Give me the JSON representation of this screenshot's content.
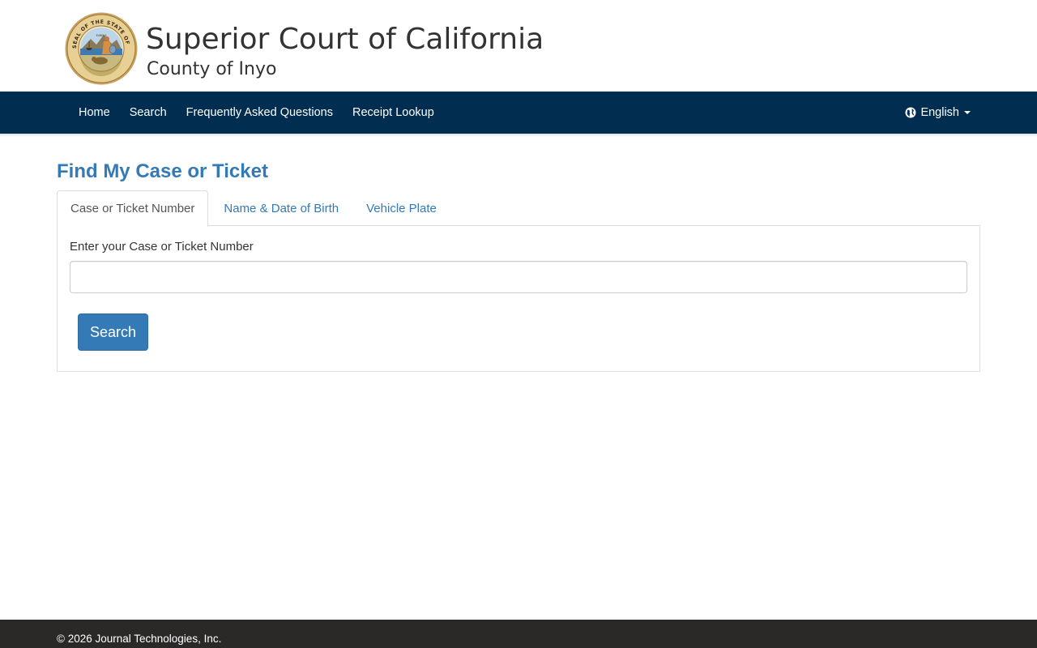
{
  "header": {
    "court_name": "Superior Court of California",
    "county_name": "County of Inyo",
    "seal_icon": "california-state-seal-icon",
    "seal_text": "THE GREAT SEAL OF THE STATE OF CALIFORNIA",
    "seal_motto": "EUREKA"
  },
  "nav": {
    "items": [
      {
        "label": "Home"
      },
      {
        "label": "Search"
      },
      {
        "label": "Frequently Asked Questions"
      },
      {
        "label": "Receipt Lookup"
      }
    ],
    "language": "English",
    "language_icon": "globe-icon",
    "background_color": "#002d50"
  },
  "main": {
    "title": "Find My Case or Ticket",
    "tabs": [
      {
        "label": "Case or Ticket Number",
        "active": true
      },
      {
        "label": "Name & Date of Birth",
        "active": false
      },
      {
        "label": "Vehicle Plate",
        "active": false
      }
    ],
    "form": {
      "label": "Enter your Case or Ticket Number",
      "value": "",
      "placeholder": "",
      "search_label": "Search"
    },
    "accent_color": "#337ab7"
  },
  "footer": {
    "copyright": "© 2026 Journal Technologies, Inc.",
    "background_color": "#2b2828"
  }
}
